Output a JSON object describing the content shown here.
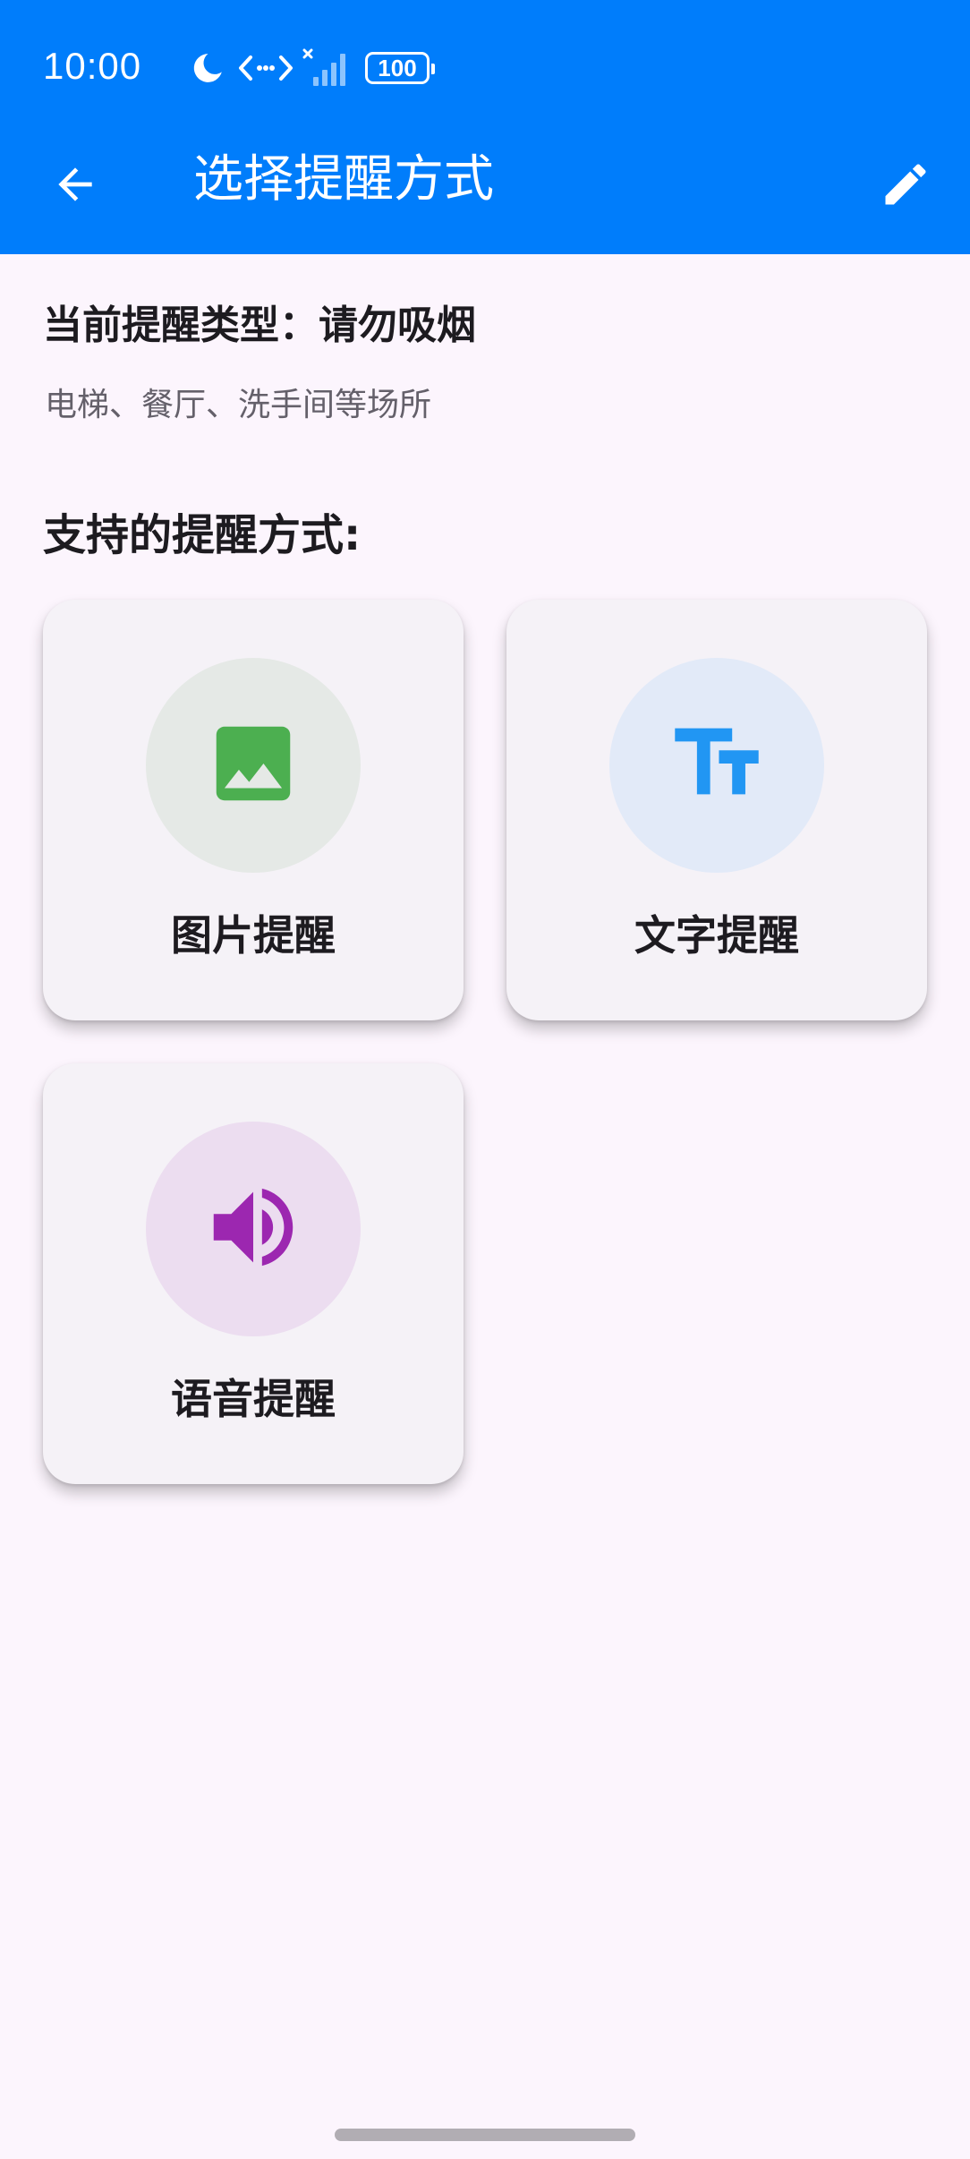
{
  "status_bar": {
    "time": "10:00",
    "battery": "100",
    "icons": [
      "moon-icon",
      "data-arrows-icon",
      "signal-icon",
      "battery-icon"
    ]
  },
  "app_bar": {
    "title": "选择提醒方式",
    "back_icon": "arrow-back-icon",
    "edit_icon": "pencil-icon",
    "background": "#007DFB"
  },
  "current": {
    "type_line": "当前提醒类型：请勿吸烟",
    "description": "电梯、餐厅、洗手间等场所"
  },
  "methods_heading": "支持的提醒方式:",
  "methods": [
    {
      "label": "图片提醒",
      "icon": "image-icon",
      "icon_color": "#4CAF50",
      "circle_color": "#E5E9E6"
    },
    {
      "label": "文字提醒",
      "icon": "text-fields-icon",
      "icon_color": "#2196F3",
      "circle_color": "#E2EAF8"
    },
    {
      "label": "语音提醒",
      "icon": "volume-up-icon",
      "icon_color": "#9C27B0",
      "circle_color": "#ECDDF0"
    }
  ]
}
